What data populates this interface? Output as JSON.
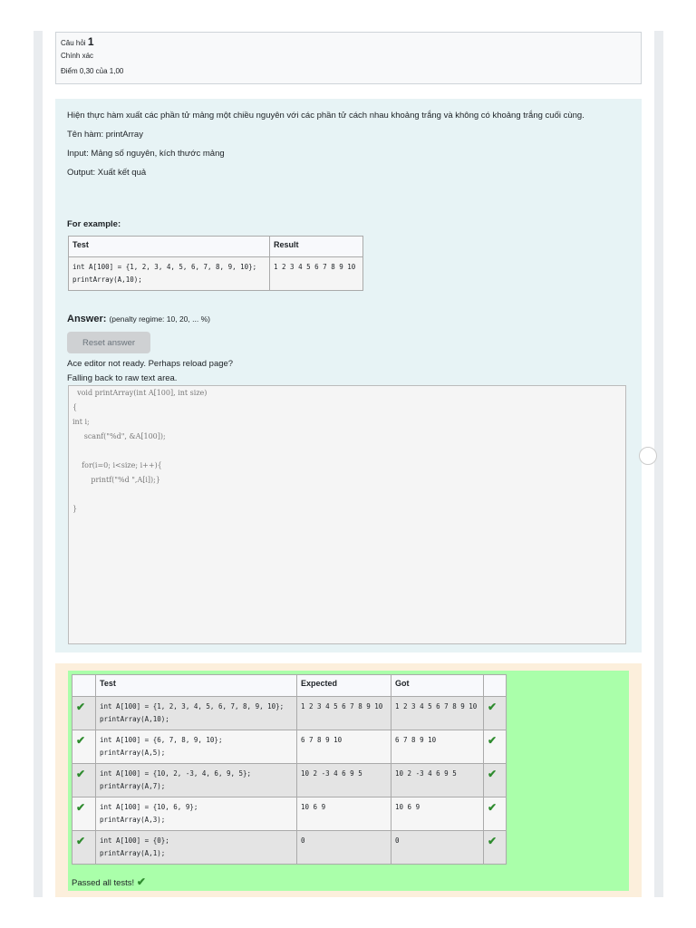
{
  "info": {
    "question_label": "Câu hỏi",
    "question_number": "1",
    "status": "Chính xác",
    "grade": "Điểm 0,30 của 1,00"
  },
  "question": {
    "description": "Hiện thực hàm xuất các phần tử mảng một chiều nguyên với các phần tử cách nhau khoảng trắng và không có khoảng trắng cuối cùng.",
    "function_name": "Tên hàm: printArray",
    "input": "Input: Mảng số nguyên, kích thước mảng",
    "output": "Output: Xuất kết quả",
    "for_example": "For example:",
    "example": {
      "headers": [
        "Test",
        "Result"
      ],
      "rows": [
        {
          "test": "int A[100] = {1, 2, 3, 4, 5, 6, 7, 8, 9, 10};\nprintArray(A,10);",
          "result": "1 2 3 4 5 6 7 8 9 10"
        }
      ]
    },
    "answer_label": "Answer:",
    "penalty": "(penalty regime: 10, 20, ... %)",
    "reset_button": "Reset answer",
    "ace_msg": "Ace editor not ready. Perhaps reload page?",
    "fallback_msg": "Falling back to raw text area.",
    "code": "  void printArray(int A[100], int size)\n{\nint i;\n     scanf(\"%d\", &A[100]);\n\n    for(i=0; i<size; i++){\n        printf(\"%d \",A[i]);}\n\n}"
  },
  "results": {
    "headers": [
      "",
      "Test",
      "Expected",
      "Got",
      ""
    ],
    "rows": [
      {
        "test": "int A[100] = {1, 2, 3, 4, 5, 6, 7, 8, 9, 10};\nprintArray(A,10);",
        "expected": "1 2 3 4 5 6 7 8 9 10",
        "got": "1 2 3 4 5 6 7 8 9 10",
        "mark": "✔"
      },
      {
        "test": "int A[100] = {6, 7, 8, 9, 10};\nprintArray(A,5);",
        "expected": "6 7 8 9 10",
        "got": "6 7 8 9 10",
        "mark": "✔"
      },
      {
        "test": "int A[100] = {10, 2, -3, 4, 6, 9, 5};\nprintArray(A,7);",
        "expected": "10 2 -3 4 6 9 5",
        "got": "10 2 -3 4 6 9 5",
        "mark": "✔"
      },
      {
        "test": "int A[100] = {10, 6, 9};\nprintArray(A,3);",
        "expected": "10 6 9",
        "got": "10 6 9",
        "mark": "✔"
      },
      {
        "test": "int A[100] = {0};\nprintArray(A,1);",
        "expected": "0",
        "got": "0",
        "mark": "✔"
      }
    ],
    "passed": "Passed all tests!",
    "passed_mark": "✔"
  }
}
